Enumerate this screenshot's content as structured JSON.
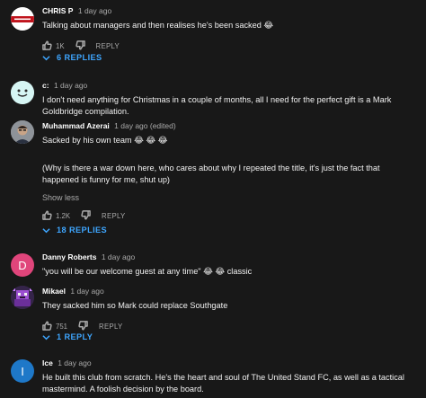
{
  "comments": [
    {
      "author": "CHRIS P",
      "time": "1 day ago",
      "text": "Talking about managers and then realises he's been sacked 😂",
      "likes": "1K",
      "reply_label": "REPLY",
      "replies_label": "6 REPLIES"
    },
    {
      "author": "c:",
      "time": "1 day ago",
      "text": "I don't need anything for Christmas in a couple of months, all I need for the perfect gift is a Mark Goldbridge compilation."
    },
    {
      "author": "Muhammad Azerai",
      "time": "1 day ago (edited)",
      "text": "Sacked by his own team 😂 😂 😂",
      "text2": "(Why is there a  war down here, who cares about why I repeated the title, it's just the fact that happened is funny for me, shut up)",
      "show_less": "Show less",
      "likes": "1.2K",
      "reply_label": "REPLY",
      "replies_label": "18 REPLIES"
    },
    {
      "author": "Danny Roberts",
      "time": "1 day ago",
      "text": "\"you will be our welcome guest at any time\" 😂 😂 classic",
      "avatar_letter": "D",
      "avatar_color": "#e0457b"
    },
    {
      "author": "Mikael",
      "time": "1 day ago",
      "text": "They sacked him so Mark could replace Southgate",
      "likes": "751",
      "reply_label": "REPLY",
      "replies_label": "1 REPLY"
    },
    {
      "author": "Ice",
      "time": "1 day ago",
      "text": "He built this club from scratch. He's the heart and soul of The United Stand FC, as well as a tactical mastermind. A foolish decision by the board.",
      "avatar_letter": "I",
      "avatar_color": "#1e78c8"
    }
  ],
  "colors": {
    "background": "#181818",
    "link_blue": "#3ea6ff",
    "secondary_text": "#aaaaaa"
  },
  "icons": [
    "thumbs-up-icon",
    "thumbs-down-icon",
    "chevron-down-icon"
  ]
}
